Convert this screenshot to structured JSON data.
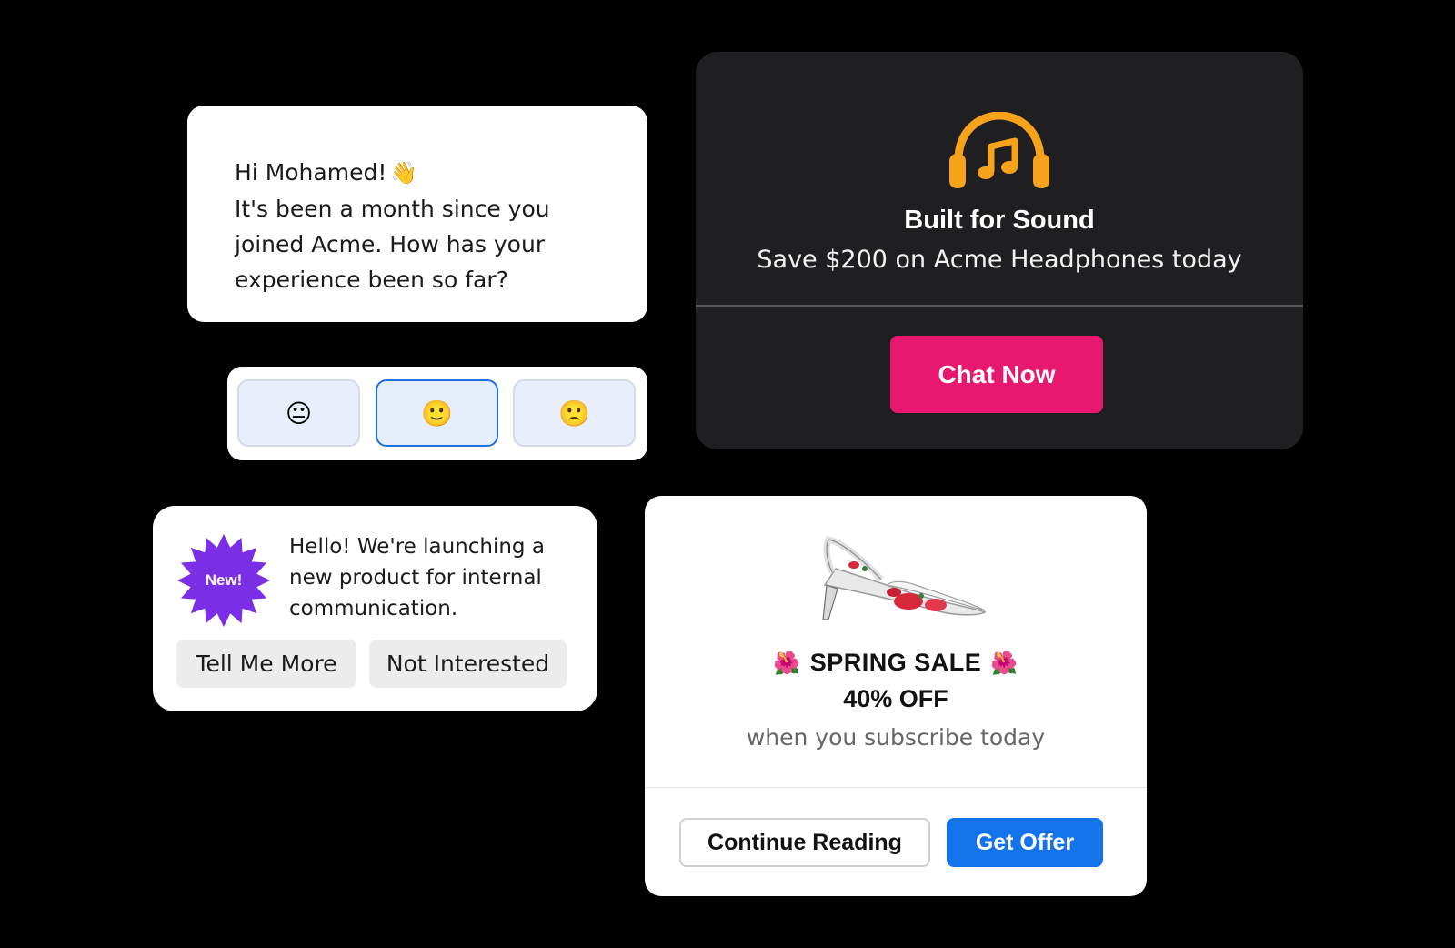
{
  "greeting_card": {
    "line1": "Hi Mohamed!",
    "wave_emoji": "👋",
    "line2": "It's been a month since you",
    "line3": "joined Acme. How has your",
    "line4": "experience been so far?"
  },
  "rating": {
    "options": [
      {
        "emoji": "😐",
        "icon": "neutral-face"
      },
      {
        "emoji": "🙂",
        "icon": "slightly-smiling-face",
        "selected": true
      },
      {
        "emoji": "🙁",
        "icon": "slightly-frowning-face"
      }
    ],
    "selected_index": 1
  },
  "promo_card": {
    "icon": "headphones-music-icon",
    "title": "Built for Sound",
    "subtitle": "Save $200 on Acme Headphones today",
    "button_label": "Chat Now",
    "accent_color": "#f7a21b",
    "button_color": "#e8176f"
  },
  "launch_card": {
    "badge_label": "New!",
    "badge_color": "#7a2fe6",
    "message_lines": [
      "Hello! We're launching a",
      "new product for internal",
      "communication."
    ],
    "primary_label": "Tell Me More",
    "secondary_label": "Not Interested"
  },
  "sale_card": {
    "image": "high-heel-shoe",
    "flower_emoji": "🌺",
    "title": "SPRING SALE",
    "discount": "40% OFF",
    "subtitle": "when you subscribe today",
    "secondary_label": "Continue Reading",
    "primary_label": "Get Offer",
    "primary_color": "#1273ea"
  }
}
